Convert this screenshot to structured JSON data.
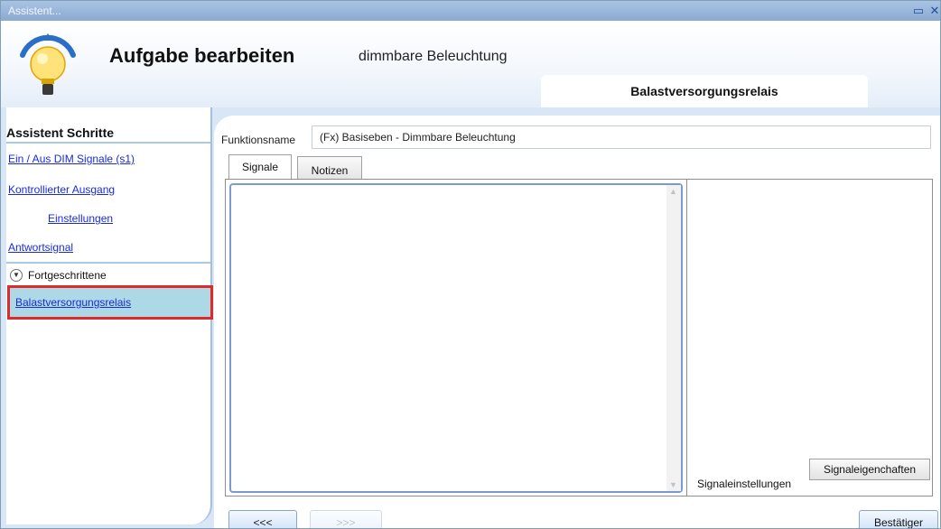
{
  "window": {
    "title": "Assistent...",
    "icons": [
      "restore-icon",
      "close-icon"
    ]
  },
  "header": {
    "icon": "light-bulb-icon",
    "title": "Aufgabe bearbeiten",
    "subtitle": "dimmbare Beleuchtung",
    "current_step": "Balastversorgungsrelais"
  },
  "sidebar": {
    "heading": "Assistent Schritte",
    "items": [
      {
        "label": "Ein / Aus DIM Signale (s1)"
      },
      {
        "label": "Kontrollierter Ausgang"
      },
      {
        "label": "Einstellungen"
      },
      {
        "label": "Antwortsignal"
      }
    ],
    "advanced_label": "Fortgeschrittene",
    "active_item": "Balastversorgungsrelais"
  },
  "form": {
    "function_name_label": "Funktionsname",
    "function_name_value": "(Fx) Basiseben - Dimmbare Beleuchtung"
  },
  "tabs": {
    "signals": "Signale",
    "notes": "Notizen"
  },
  "side_tabs": {
    "settings": "Signaleinstellungen",
    "properties": "Signaleigenchaften"
  },
  "buttons": {
    "back": "<<<",
    "next": ">>>",
    "confirm": "Bestätiger"
  },
  "colors": {
    "accent": "#1a2bd8",
    "active_bg": "#add8e6",
    "highlight_border": "#dd2b2b"
  }
}
